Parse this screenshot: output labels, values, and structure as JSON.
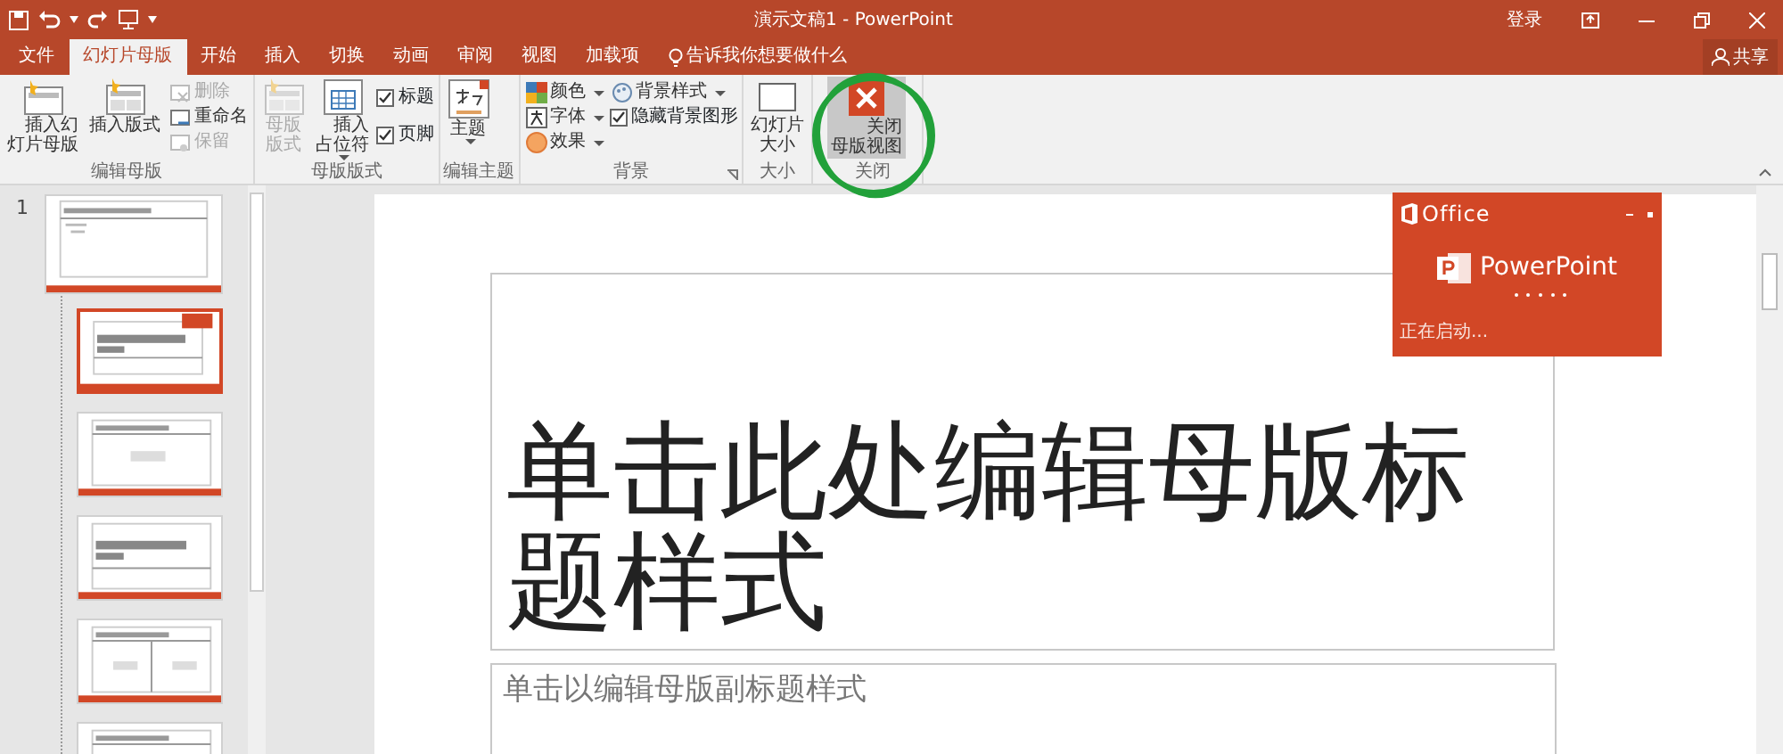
{
  "window": {
    "title": "演示文稿1 - PowerPoint",
    "sign_in": "登录"
  },
  "tabs": [
    {
      "label": "文件",
      "selected": false
    },
    {
      "label": "幻灯片母版",
      "selected": true
    },
    {
      "label": "开始",
      "selected": false
    },
    {
      "label": "插入",
      "selected": false
    },
    {
      "label": "切换",
      "selected": false
    },
    {
      "label": "动画",
      "selected": false
    },
    {
      "label": "审阅",
      "selected": false
    },
    {
      "label": "视图",
      "selected": false
    },
    {
      "label": "加载项",
      "selected": false
    }
  ],
  "tell_me": "告诉我你想要做什么",
  "share": "共享",
  "ribbon": [
    {
      "label": "编辑母版",
      "items": [
        {
          "kind": "large",
          "label": "插入幻灯片母版",
          "disabled": false,
          "dropdown": false,
          "highlighted": false
        },
        {
          "kind": "large",
          "label": "插入版式",
          "disabled": false,
          "dropdown": false,
          "highlighted": false
        },
        {
          "kind": "stack",
          "items": [
            {
              "kind": "small",
              "label": "删除",
              "disabled": true,
              "dropdown": false
            },
            {
              "kind": "small",
              "label": "重命名",
              "disabled": false,
              "dropdown": false
            },
            {
              "kind": "small",
              "label": "保留",
              "disabled": true,
              "dropdown": false
            }
          ]
        }
      ]
    },
    {
      "label": "母版版式",
      "items": [
        {
          "kind": "large",
          "label": "母版版式",
          "disabled": true,
          "dropdown": false,
          "highlighted": false
        },
        {
          "kind": "large",
          "label": "插入占位符",
          "disabled": false,
          "dropdown": true,
          "highlighted": false
        },
        {
          "kind": "checks",
          "items": [
            {
              "label": "标题",
              "checked": true
            },
            {
              "label": "页脚",
              "checked": true
            }
          ]
        }
      ]
    },
    {
      "label": "编辑主题",
      "items": [
        {
          "kind": "large",
          "label": "主题",
          "disabled": false,
          "dropdown": true,
          "highlighted": false
        }
      ]
    },
    {
      "label": "背景",
      "items": [
        {
          "kind": "stack",
          "items": [
            {
              "kind": "small",
              "label": "颜色",
              "disabled": false,
              "dropdown": true
            },
            {
              "kind": "small",
              "label": "字体",
              "disabled": false,
              "dropdown": true
            },
            {
              "kind": "small",
              "label": "效果",
              "disabled": false,
              "dropdown": true
            }
          ]
        },
        {
          "kind": "stack",
          "items": [
            {
              "kind": "small",
              "label": "背景样式",
              "disabled": false,
              "dropdown": true
            },
            {
              "kind": "check",
              "label": "隐藏背景图形",
              "checked": true
            }
          ]
        }
      ],
      "launcher": true
    },
    {
      "label": "大小",
      "items": [
        {
          "kind": "large",
          "label": "幻灯片大小",
          "disabled": false,
          "dropdown": false,
          "highlighted": false
        }
      ]
    },
    {
      "label": "关闭",
      "items": [
        {
          "kind": "large",
          "label": "关闭母版视图",
          "disabled": false,
          "dropdown": false,
          "highlighted": true
        }
      ]
    }
  ],
  "thumbnails": {
    "number": "1",
    "slides": [
      {
        "kind": "master",
        "selected": false
      },
      {
        "kind": "title",
        "selected": true
      },
      {
        "kind": "content",
        "selected": false
      },
      {
        "kind": "section",
        "selected": false
      },
      {
        "kind": "two",
        "selected": false
      },
      {
        "kind": "content",
        "selected": false
      }
    ]
  },
  "slide": {
    "title": "单击此处编辑母版标题样式",
    "subtitle": "单击以编辑母版副标题样式"
  },
  "splash": {
    "brand": "Office",
    "app": "PowerPoint",
    "status": "正在启动..."
  }
}
